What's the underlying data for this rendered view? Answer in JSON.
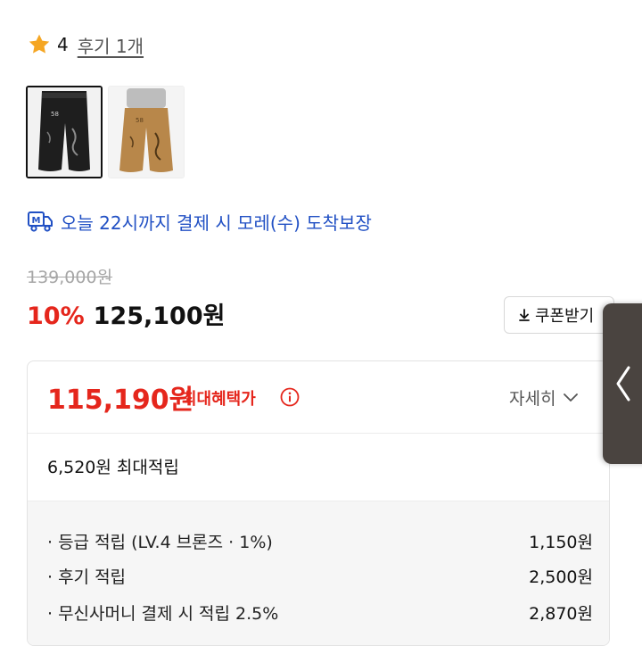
{
  "rating": {
    "value": "4",
    "review_link": "후기 1개",
    "icon": "star-icon"
  },
  "thumbnails": [
    {
      "alt": "black cargo pants",
      "selected": true
    },
    {
      "alt": "beige cargo pants",
      "selected": false
    }
  ],
  "delivery": {
    "icon": "truck-icon",
    "text": "오늘 22시까지 결제 시 모레(수) 도착보장"
  },
  "price": {
    "original": "139,000원",
    "discount_rate": "10%",
    "sale_price": "125,100원"
  },
  "coupon_button": {
    "label": "쿠폰받기",
    "icon": "download-icon"
  },
  "benefit": {
    "max_price": "115,190원",
    "max_label": "최대혜택가",
    "detail_toggle": "자세히",
    "points_summary": "6,520원 최대적립",
    "rows": [
      {
        "label": "· 등급 적립 (LV.4 브론즈 · 1%)",
        "amount": "1,150원"
      },
      {
        "label": "· 후기 적립",
        "amount": "2,500원"
      },
      {
        "label": "· 무신사머니 결제 시 적립 2.5%",
        "amount": "2,870원"
      }
    ]
  },
  "colors": {
    "accent_red": "#e5261c",
    "link_blue": "#2150c4",
    "star": "#f5a623"
  }
}
